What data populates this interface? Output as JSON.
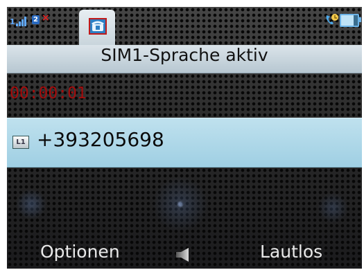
{
  "status_bar": {
    "sim1_label": "1",
    "sim2_label": "2",
    "sim2_status": "×",
    "active_tab_icon": "phone-call-icon",
    "right_icons": [
      "phone-active-icon",
      "battery-icon"
    ],
    "accent_color": "#5fa8ff"
  },
  "title_bar": {
    "title": "SIM1-Sprache aktiv"
  },
  "call": {
    "timer": "00:00:01",
    "line_badge": "L1",
    "number": "+393205698"
  },
  "softkeys": {
    "left": "Optionen",
    "center_icon": "speaker-icon",
    "right": "Lautlos"
  },
  "colors": {
    "timer": "#a30d0d",
    "title_bar": "#c9d5dc",
    "number_row": "#b0d9ea"
  }
}
